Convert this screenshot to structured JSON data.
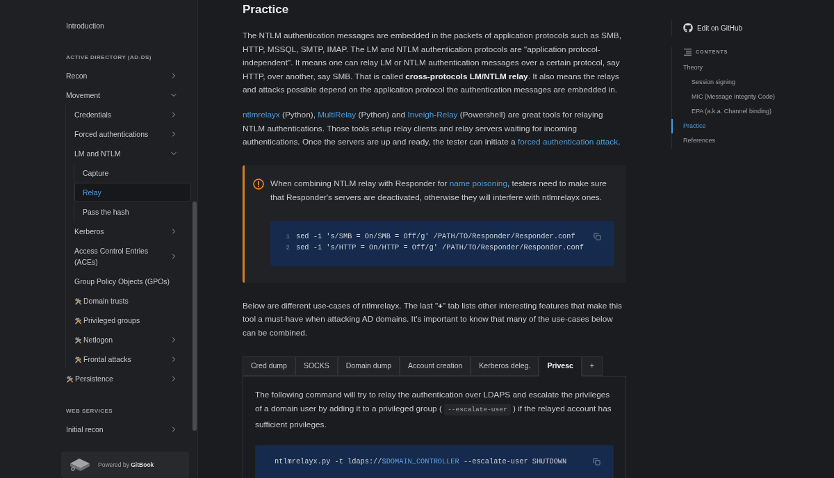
{
  "sidebar": {
    "sections": [
      {
        "items": [
          {
            "label": "Introduction",
            "kind": "page",
            "selected": false
          }
        ]
      },
      {
        "title": "ACTIVE DIRECTORY (AD-DS)",
        "items": [
          {
            "label": "Recon",
            "kind": "page",
            "selected": false,
            "expanded": false
          },
          {
            "label": "Movement",
            "kind": "page",
            "selected": false,
            "expanded": true,
            "children": [
              {
                "label": "Credentials",
                "kind": "page",
                "selected": false,
                "expanded": false
              },
              {
                "label": "Forced authentications",
                "kind": "page",
                "selected": false,
                "expanded": false
              },
              {
                "label": "LM and NTLM",
                "kind": "page",
                "selected": false,
                "expanded": true,
                "children": [
                  {
                    "label": "Capture",
                    "kind": "page",
                    "selected": false
                  },
                  {
                    "label": "Relay",
                    "kind": "page",
                    "selected": true
                  },
                  {
                    "label": "Pass the hash",
                    "kind": "page",
                    "selected": false
                  }
                ]
              },
              {
                "label": "Kerberos",
                "kind": "page",
                "selected": false,
                "expanded": false
              },
              {
                "label": "Access Control Entries (ACEs)",
                "kind": "page",
                "selected": false,
                "expanded": false
              },
              {
                "label": "Group Policy Objects (GPOs)",
                "kind": "page",
                "selected": false
              },
              {
                "label": "Domain trusts",
                "kind": "tools",
                "selected": false
              },
              {
                "label": "Privileged groups",
                "kind": "tools",
                "selected": false
              },
              {
                "label": "Netlogon",
                "kind": "tools",
                "selected": false,
                "expanded": false
              },
              {
                "label": "Frontal attacks",
                "kind": "tools",
                "selected": false,
                "expanded": false
              }
            ]
          },
          {
            "label": "Persistence",
            "kind": "tools",
            "selected": false,
            "expanded": false
          }
        ]
      },
      {
        "title": "WEB SERVICES",
        "items": [
          {
            "label": "Initial recon",
            "kind": "page",
            "selected": false,
            "expanded": false
          }
        ]
      }
    ],
    "footer": "Powered by **GitBook**"
  },
  "page": {
    "heading": "Practice",
    "blocks": [
      {
        "kind": "paragraph",
        "segments": [
          {
            "kind": "text",
            "text": "The NTLM authentication messages are embedded in the packets of application protocols such as SMB, HTTP, MSSQL, SMTP, IMAP. The LM and NTLM authentication protocols are \"application protocol-independent\". It means one can relay LM or NTLM authentication messages over a certain protocol, say HTTP, over another, say SMB. That is called **cross-protocols LM/NTLM relay**. It also means the relays and attacks possible depend on the application protocol the authentication messages are embedded in."
          }
        ]
      },
      {
        "kind": "paragraph",
        "segments": [
          {
            "kind": "link",
            "text": "ntlmrelayx"
          },
          {
            "kind": "text",
            "text": " (Python), "
          },
          {
            "kind": "link",
            "text": "MultiRelay"
          },
          {
            "kind": "text",
            "text": " (Python) and "
          },
          {
            "kind": "link",
            "text": "Inveigh-Relay"
          },
          {
            "kind": "text",
            "text": " (Powershell) are great tools for relaying NTLM authentications. Those tools setup relay clients and relay servers waiting for incoming authentications. Once the servers are up and ready, the tester can initiate a "
          },
          {
            "kind": "link",
            "text": "forced authentication attack"
          },
          {
            "kind": "text",
            "text": "."
          }
        ]
      },
      {
        "kind": "hint",
        "segments": [
          {
            "kind": "text",
            "text": "When combining NTLM relay with Responder for "
          },
          {
            "kind": "link",
            "text": "name poisoning"
          },
          {
            "kind": "text",
            "text": ", testers need to make sure that Responder's servers are deactivated, otherwise they will interfere with ntlmrelayx ones."
          }
        ],
        "code": {
          "lines": [
            {
              "number": "1",
              "tokens": [
                {
                  "kind": "plain",
                  "text": "sed -i 's/SMB = On/SMB = Off/g' /PATH/TO/Responder/Responder.conf"
                }
              ]
            },
            {
              "number": "2",
              "tokens": [
                {
                  "kind": "plain",
                  "text": "sed -i 's/HTTP = On/HTTP = Off/g' /PATH/TO/Responder/Responder.conf"
                }
              ]
            }
          ]
        }
      },
      {
        "kind": "paragraph",
        "segments": [
          {
            "kind": "text",
            "text": "Below are different use-cases of ntlmrelayx. The last \"**+**\" tab lists other interesting features that make this tool a must-have when attacking AD domains. It's important to know that many of the use-cases below can be combined."
          }
        ]
      },
      {
        "kind": "tabs",
        "tabs": [
          {
            "label": "Cred dump",
            "selected": false
          },
          {
            "label": "SOCKS",
            "selected": false
          },
          {
            "label": "Domain dump",
            "selected": false
          },
          {
            "label": "Account creation",
            "selected": false
          },
          {
            "label": "Kerberos deleg.",
            "selected": false
          },
          {
            "label": "Privesc",
            "selected": true
          },
          {
            "label": "+",
            "selected": false
          }
        ],
        "panel": {
          "segments": [
            {
              "kind": "text",
              "text": "The following command will try to relay the authentication over LDAPS and escalate the privileges of a domain user by adding it to a privileged group ( "
            },
            {
              "kind": "code",
              "text": "--escalate-user"
            },
            {
              "kind": "text",
              "text": " ) if the relayed account has sufficient privileges."
            }
          ],
          "code": {
            "lines": [
              {
                "tokens": [
                  {
                    "kind": "plain",
                    "text": "ntlmrelayx.py -t ldaps://"
                  },
                  {
                    "kind": "variable",
                    "text": "$DOMAIN_CONTROLLER"
                  },
                  {
                    "kind": "plain",
                    "text": " --escalate-user SHUTDOWN"
                  }
                ]
              }
            ]
          }
        }
      }
    ]
  },
  "toc": {
    "edit_link": "Edit on GitHub",
    "title": "CONTENTS",
    "items": [
      {
        "label": "Theory",
        "selected": false,
        "children": [
          {
            "label": "Session signing",
            "selected": false
          },
          {
            "label": "MIC (Message Integrity Code)",
            "selected": false
          },
          {
            "label": "EPA (a.k.a. Channel binding)",
            "selected": false
          }
        ]
      },
      {
        "label": "Practice",
        "selected": true
      },
      {
        "label": "References",
        "selected": false
      }
    ]
  }
}
